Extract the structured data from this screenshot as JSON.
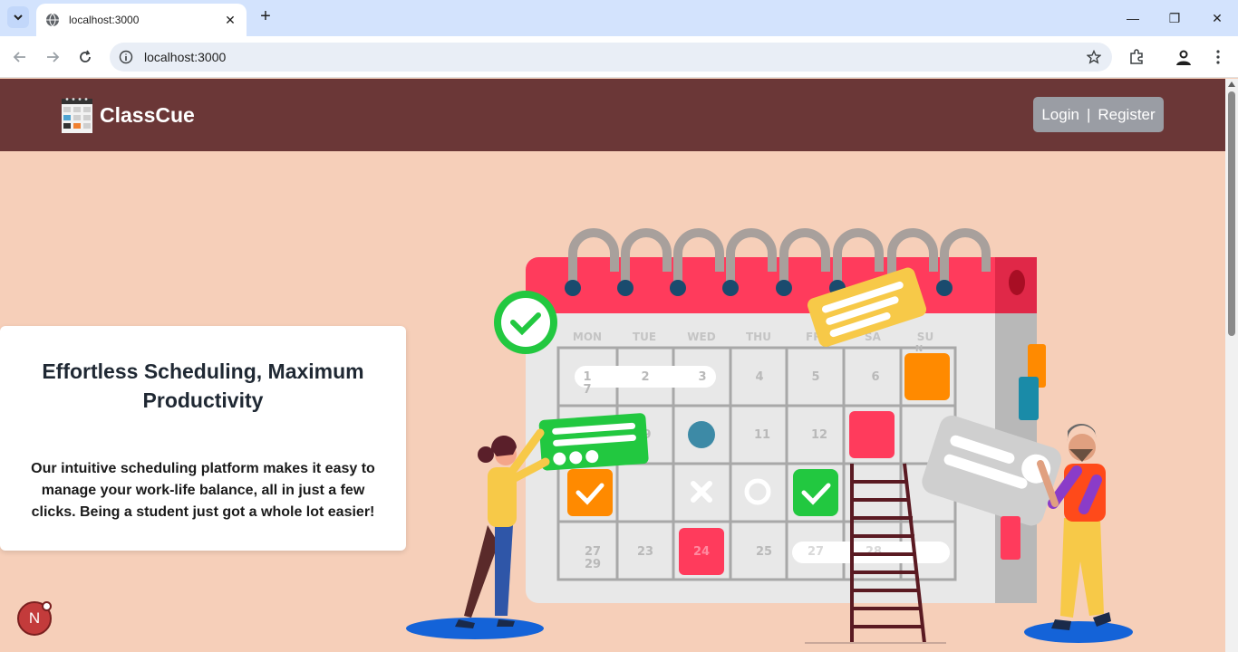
{
  "browser": {
    "tab_title": "localhost:3000",
    "url": "localhost:3000",
    "new_tab_label": "+",
    "close_label": "✕",
    "minimize_label": "—",
    "restore_label": "❐",
    "window_close_label": "✕"
  },
  "header": {
    "brand_name": "ClassCue",
    "login_label": "Login",
    "separator": "|",
    "register_label": "Register",
    "colors": {
      "header_bg": "#6b3737",
      "auth_bg": "#9a9da4"
    }
  },
  "hero_card": {
    "title": "Effortless Scheduling, Maximum Productivity",
    "body": "Our intuitive scheduling platform makes it easy to manage your work-life balance, all in just a few clicks. Being a student just got a whole lot easier!"
  },
  "calendar": {
    "day_headers": [
      "MON",
      "TUE",
      "WED",
      "THU",
      "FRI",
      "SA",
      "SU"
    ],
    "row1": [
      "1",
      "2",
      "3",
      "4",
      "5",
      "6",
      ""
    ],
    "row2": [
      "",
      "",
      "",
      "11",
      "12",
      "",
      ""
    ],
    "row4": [
      "27",
      "23",
      "24",
      "25",
      "27",
      "28",
      ""
    ],
    "extra_labels": [
      "7",
      "9",
      "29",
      "N"
    ]
  },
  "dev_badge": {
    "label": "N"
  },
  "colors": {
    "page_bg": "#f6cfb9",
    "accent_red": "#ff3b5c",
    "accent_green": "#22c840",
    "accent_orange": "#ff8a00"
  }
}
